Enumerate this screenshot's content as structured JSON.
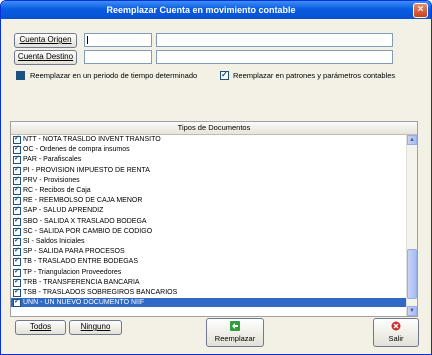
{
  "window": {
    "title": "Reemplazar Cuenta en movimiento contable"
  },
  "origen": {
    "button_label": "Cuenta Origen",
    "code": "",
    "description": ""
  },
  "destino": {
    "button_label": "Cuenta Destino",
    "code": "",
    "description": ""
  },
  "options": {
    "period_label": "Reemplazar en un periodo de tiempo determinado",
    "period_checked": false,
    "patterns_label": "Reemplazar en patrones y parámetros contables",
    "patterns_checked": true
  },
  "documents": {
    "header": "Tipos de Documentos",
    "items": [
      {
        "label": "NTT - NOTA TRASLDO INVENT TRANSITO",
        "checked": true
      },
      {
        "label": "OC - Ordenes de compra insumos",
        "checked": true
      },
      {
        "label": "PAR - Parafiscales",
        "checked": true
      },
      {
        "label": "PI - PROVISION IMPUESTO DE RENTA",
        "checked": true
      },
      {
        "label": "PRV - Provisiones",
        "checked": true
      },
      {
        "label": "RC - Recibos de Caja",
        "checked": true
      },
      {
        "label": "RE - REEMBOLSO DE CAJA MENOR",
        "checked": true
      },
      {
        "label": "SAP - SALUD APRENDIZ",
        "checked": true
      },
      {
        "label": "SBO - SALIDA X TRASLADO BODEGA",
        "checked": true
      },
      {
        "label": "SC - SALIDA POR CAMBIO DE CODIGO",
        "checked": true
      },
      {
        "label": "SI - Saldos Iniciales",
        "checked": true
      },
      {
        "label": "SP - SALIDA PARA PROCESOS",
        "checked": true
      },
      {
        "label": "TB - TRASLADO ENTRE BODEGAS",
        "checked": true
      },
      {
        "label": "TP - Triangulacion Proveedores",
        "checked": true
      },
      {
        "label": "TRB - TRANSFERENCIA BANCARIA",
        "checked": true
      },
      {
        "label": "TSB - TRASLADOS SOBREGIROS BANCARIOS",
        "checked": true
      },
      {
        "label": "UNN - UN NUEVO DOCUMENTO NIIF",
        "checked": true,
        "selected": true
      }
    ]
  },
  "buttons": {
    "todos": "Todos",
    "ninguno": "Ninguno",
    "reemplazar": "Reemplazar",
    "salir": "Salir"
  },
  "colors": {
    "titlebar": "#0a5ce0",
    "selection": "#316ac5",
    "checkbox": "#1c5180"
  }
}
